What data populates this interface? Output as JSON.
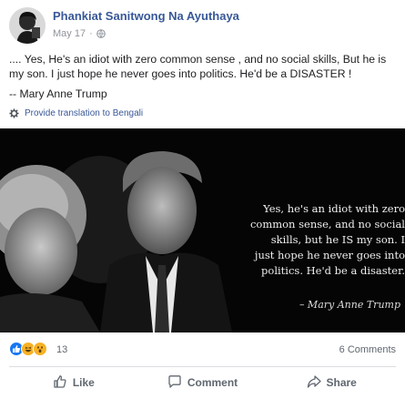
{
  "post": {
    "author": "Phankiat Sanitwong Na Ayuthaya",
    "date": "May 17",
    "separator": "·",
    "text_line": ".... Yes, He's an idiot with zero common sense , and no social skills, But he is my son. I just hope he never goes into politics. He'd be a DISASTER !",
    "attribution": "-- Mary Anne Trump",
    "translate_link": "Provide translation to Bengali"
  },
  "image": {
    "quote_lines": [
      "Yes, he's an idiot with zero",
      "common sense, and no social",
      "skills, but he IS my son.  I",
      "just hope he never goes into",
      "politics. He'd be a disaster."
    ],
    "quote_attribution": "– Mary Anne Trump"
  },
  "engagement": {
    "reaction_icons": [
      "like-reaction",
      "haha-reaction",
      "wow-reaction"
    ],
    "reaction_count": "13",
    "comments": "6 Comments"
  },
  "actions": {
    "like": "Like",
    "comment": "Comment",
    "share": "Share"
  },
  "colors": {
    "link_blue": "#385898",
    "like_blue": "#1877f2",
    "haha_yellow": "#f7b125"
  }
}
